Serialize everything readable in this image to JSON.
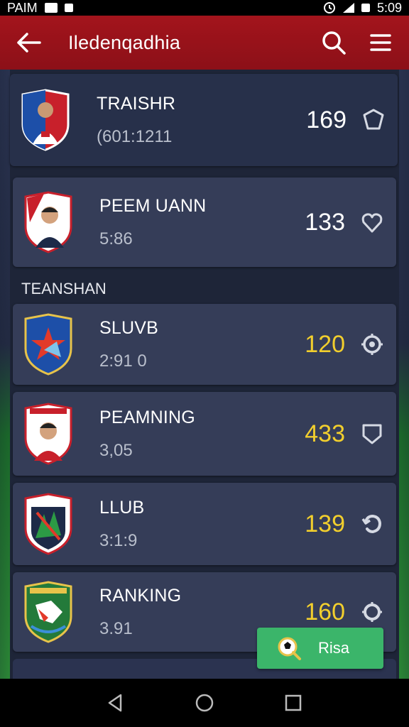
{
  "status_bar": {
    "left_text": "PAIM",
    "time": "5:09"
  },
  "app_bar": {
    "title": "Iledenqadhia"
  },
  "cards": [
    {
      "name": "TRAISHR",
      "sub": "(601:1211",
      "score": "169",
      "score_color": "#ffffff"
    },
    {
      "name": "PEEM UANN",
      "sub": "5:86",
      "score": "133",
      "score_color": "#ffffff"
    },
    {
      "name": "SLUVB",
      "sub": "2:91 0",
      "score": "120",
      "score_color": "#f2cf2d"
    },
    {
      "name": "PEAMNING",
      "sub": "3,05",
      "score": "433",
      "score_color": "#f2cf2d"
    },
    {
      "name": "LLUB",
      "sub": "3:1:9",
      "score": "139",
      "score_color": "#f2cf2d"
    },
    {
      "name": "RANKING",
      "sub": "3.91",
      "score": "160",
      "score_color": "#f2cf2d"
    }
  ],
  "section": {
    "label": "TEANSHAN"
  },
  "action_button": {
    "label": "Risa"
  },
  "colors": {
    "app_bar": "#a3141c",
    "card": "#353d58",
    "accent_yellow": "#f2cf2d",
    "action_green": "#3bb56a"
  }
}
